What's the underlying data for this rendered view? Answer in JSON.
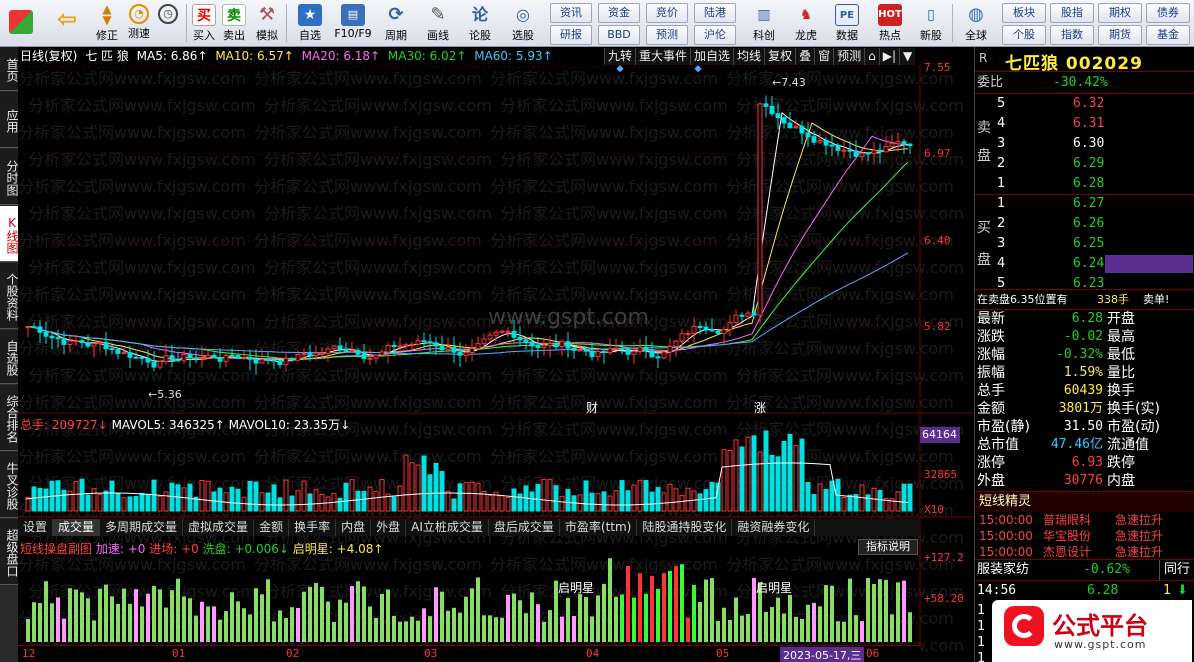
{
  "toolbar": {
    "buttons": [
      {
        "label": "",
        "icon": "grid-icon"
      },
      {
        "label": "",
        "icon": "back-arrow-icon"
      },
      {
        "label": "修正",
        "icon": "up-down-arrows-icon"
      },
      {
        "label": "测速",
        "icon": "speed-icon"
      },
      {
        "label": "",
        "icon": "clock-icon"
      },
      {
        "label": "买入",
        "icon": "buy-icon",
        "glyph": "买"
      },
      {
        "label": "卖出",
        "icon": "sell-icon",
        "glyph": "卖"
      },
      {
        "label": "模拟",
        "icon": "hammer-icon"
      },
      {
        "label": "自选",
        "icon": "star-icon"
      },
      {
        "label": "F10/F9",
        "icon": "f10-icon"
      },
      {
        "label": "周期",
        "icon": "cycle-icon"
      },
      {
        "label": "画线",
        "icon": "pen-icon"
      },
      {
        "label": "论股",
        "icon": "discuss-icon"
      },
      {
        "label": "选股",
        "icon": "select-stock-icon"
      }
    ],
    "small_buttons": [
      "资讯",
      "资金",
      "竞价",
      "陆港",
      "研报",
      "BBD",
      "预测",
      "沪伦"
    ],
    "right_buttons": [
      {
        "label": "科创",
        "icon": "kechuang-icon"
      },
      {
        "label": "龙虎",
        "icon": "dragon-tiger-icon"
      },
      {
        "label": "数据",
        "icon": "data-icon"
      },
      {
        "label": "热点",
        "icon": "hot-icon"
      },
      {
        "label": "新股",
        "icon": "new-stock-icon"
      },
      {
        "label": "全球",
        "icon": "globe-icon"
      }
    ],
    "far_right": [
      "板块",
      "股指",
      "期权",
      "债券",
      "个股",
      "指数",
      "期货",
      "基金"
    ]
  },
  "left_tabs": [
    "首页",
    "应用",
    "分时图",
    "K线图",
    "个股资料",
    "自选股",
    "综合排名",
    "牛叉诊股",
    "超级盘口"
  ],
  "chart": {
    "header": {
      "period": "日线(复权)",
      "name": "七 匹 狼",
      "ma5": "MA5: 6.86↑",
      "ma10": "MA10: 6.57↑",
      "ma20": "MA20: 6.18↑",
      "ma30": "MA30: 6.02↑",
      "ma60": "MA60: 5.93↑"
    },
    "tabs": [
      "九转",
      "重大事件",
      "加自选",
      "均线",
      "复权",
      "叠",
      "窗",
      "预测",
      "⌂",
      "▶|",
      "▼"
    ],
    "price_axis": [
      "7.55",
      "6.97",
      "6.40",
      "5.82"
    ],
    "high_label": "7.43",
    "low_label": "5.36",
    "markers": [
      "财",
      "涨"
    ],
    "volume_header": {
      "total": "总手: 209727↓",
      "mavol5": "MAVOL5: 346325↑",
      "mavol10": "MAVOL10: 23.35万↓"
    },
    "volume_axis": [
      "64164",
      "32865",
      "X10"
    ],
    "subtabs": [
      "设置",
      "成交量",
      "多周期成交量",
      "虚拟成交量",
      "金额",
      "换手率",
      "内盘",
      "外盘",
      "AI立桩成交量",
      "盘后成交量",
      "市盈率(ttm)",
      "陆股通持股变化",
      "融资融券变化"
    ],
    "indicator_header": {
      "name": "短线操盘副图",
      "jiasu": "加速: +0",
      "jinchang": "进场: +0",
      "xipan": "洗盘: +0.006↓",
      "qimingxing": "启明星: +4.08↑"
    },
    "indicator_button": "指标说明",
    "indicator_axis": [
      "+127.2",
      "+58.20"
    ],
    "indicator_text": [
      "启明星",
      "启明星"
    ],
    "month_labels": [
      "12",
      "01",
      "02",
      "03",
      "04",
      "05",
      "06"
    ],
    "date_label": "2023-05-17,三",
    "watermark": "分析家公式网www.fxjgsw.com",
    "center_watermark": "www.gspt.com"
  },
  "quote": {
    "code_label": "R",
    "title": "七匹狼",
    "code": "002029",
    "weibi_label": "委比",
    "weibi": "-30.42%",
    "sell_label": [
      "卖",
      "盘"
    ],
    "buy_label": [
      "买",
      "盘"
    ],
    "sell": [
      {
        "n": "5",
        "p": "6.32"
      },
      {
        "n": "4",
        "p": "6.31"
      },
      {
        "n": "3",
        "p": "6.30"
      },
      {
        "n": "2",
        "p": "6.29"
      },
      {
        "n": "1",
        "p": "6.28"
      }
    ],
    "buy": [
      {
        "n": "1",
        "p": "6.27"
      },
      {
        "n": "2",
        "p": "6.26"
      },
      {
        "n": "3",
        "p": "6.25"
      },
      {
        "n": "4",
        "p": "6.24"
      },
      {
        "n": "5",
        "p": "6.23"
      }
    ],
    "note_left": "在卖盘6.35位置有",
    "note_mid": "338手",
    "note_right": "卖单!",
    "stats": [
      {
        "l": "最新",
        "v": "6.28",
        "c": "green",
        "r": "开盘"
      },
      {
        "l": "涨跌",
        "v": "-0.02",
        "c": "green",
        "r": "最高"
      },
      {
        "l": "涨幅",
        "v": "-0.32%",
        "c": "green",
        "r": "最低"
      },
      {
        "l": "振幅",
        "v": "1.59%",
        "c": "yellow",
        "r": "量比"
      },
      {
        "l": "总手",
        "v": "60439",
        "c": "yellow",
        "r": "换手"
      },
      {
        "l": "金额",
        "v": "3801万",
        "c": "yellow",
        "r": "换手(实)"
      },
      {
        "l": "市盈(静)",
        "v": "31.50",
        "c": "white",
        "r": "市盈(动)"
      },
      {
        "l": "总市值",
        "v": "47.46亿",
        "c": "cyan",
        "r": "流通值"
      },
      {
        "l": "涨停",
        "v": "6.93",
        "c": "red",
        "r": "跌停"
      },
      {
        "l": "外盘",
        "v": "30776",
        "c": "red",
        "r": "内盘"
      }
    ],
    "news_title": "短线精灵",
    "news": [
      {
        "t": "15:00:00",
        "s": "普瑞眼科",
        "e": "急速拉升"
      },
      {
        "t": "15:00:00",
        "s": "华宝股份",
        "e": "急速拉升"
      },
      {
        "t": "15:00:00",
        "s": "杰恩设计",
        "e": "急速拉升"
      }
    ],
    "sector": "服装家纺",
    "sector_chg": "-0.62%",
    "sector_btn": "同行",
    "tick": {
      "time": "14:56",
      "price": "6.28",
      "vol": "1"
    },
    "tick_rows": [
      "1",
      "1",
      "1",
      "1"
    ]
  },
  "logo": {
    "text": "公式平台",
    "url": "www.gspt.com"
  },
  "colors": {
    "red": "#ff3333",
    "green": "#00e0e0",
    "ma5": "#ffffff",
    "ma10": "#ffeb3b",
    "ma20": "#ff66ff",
    "ma30": "#33ff33",
    "ma60": "#55aaff"
  }
}
